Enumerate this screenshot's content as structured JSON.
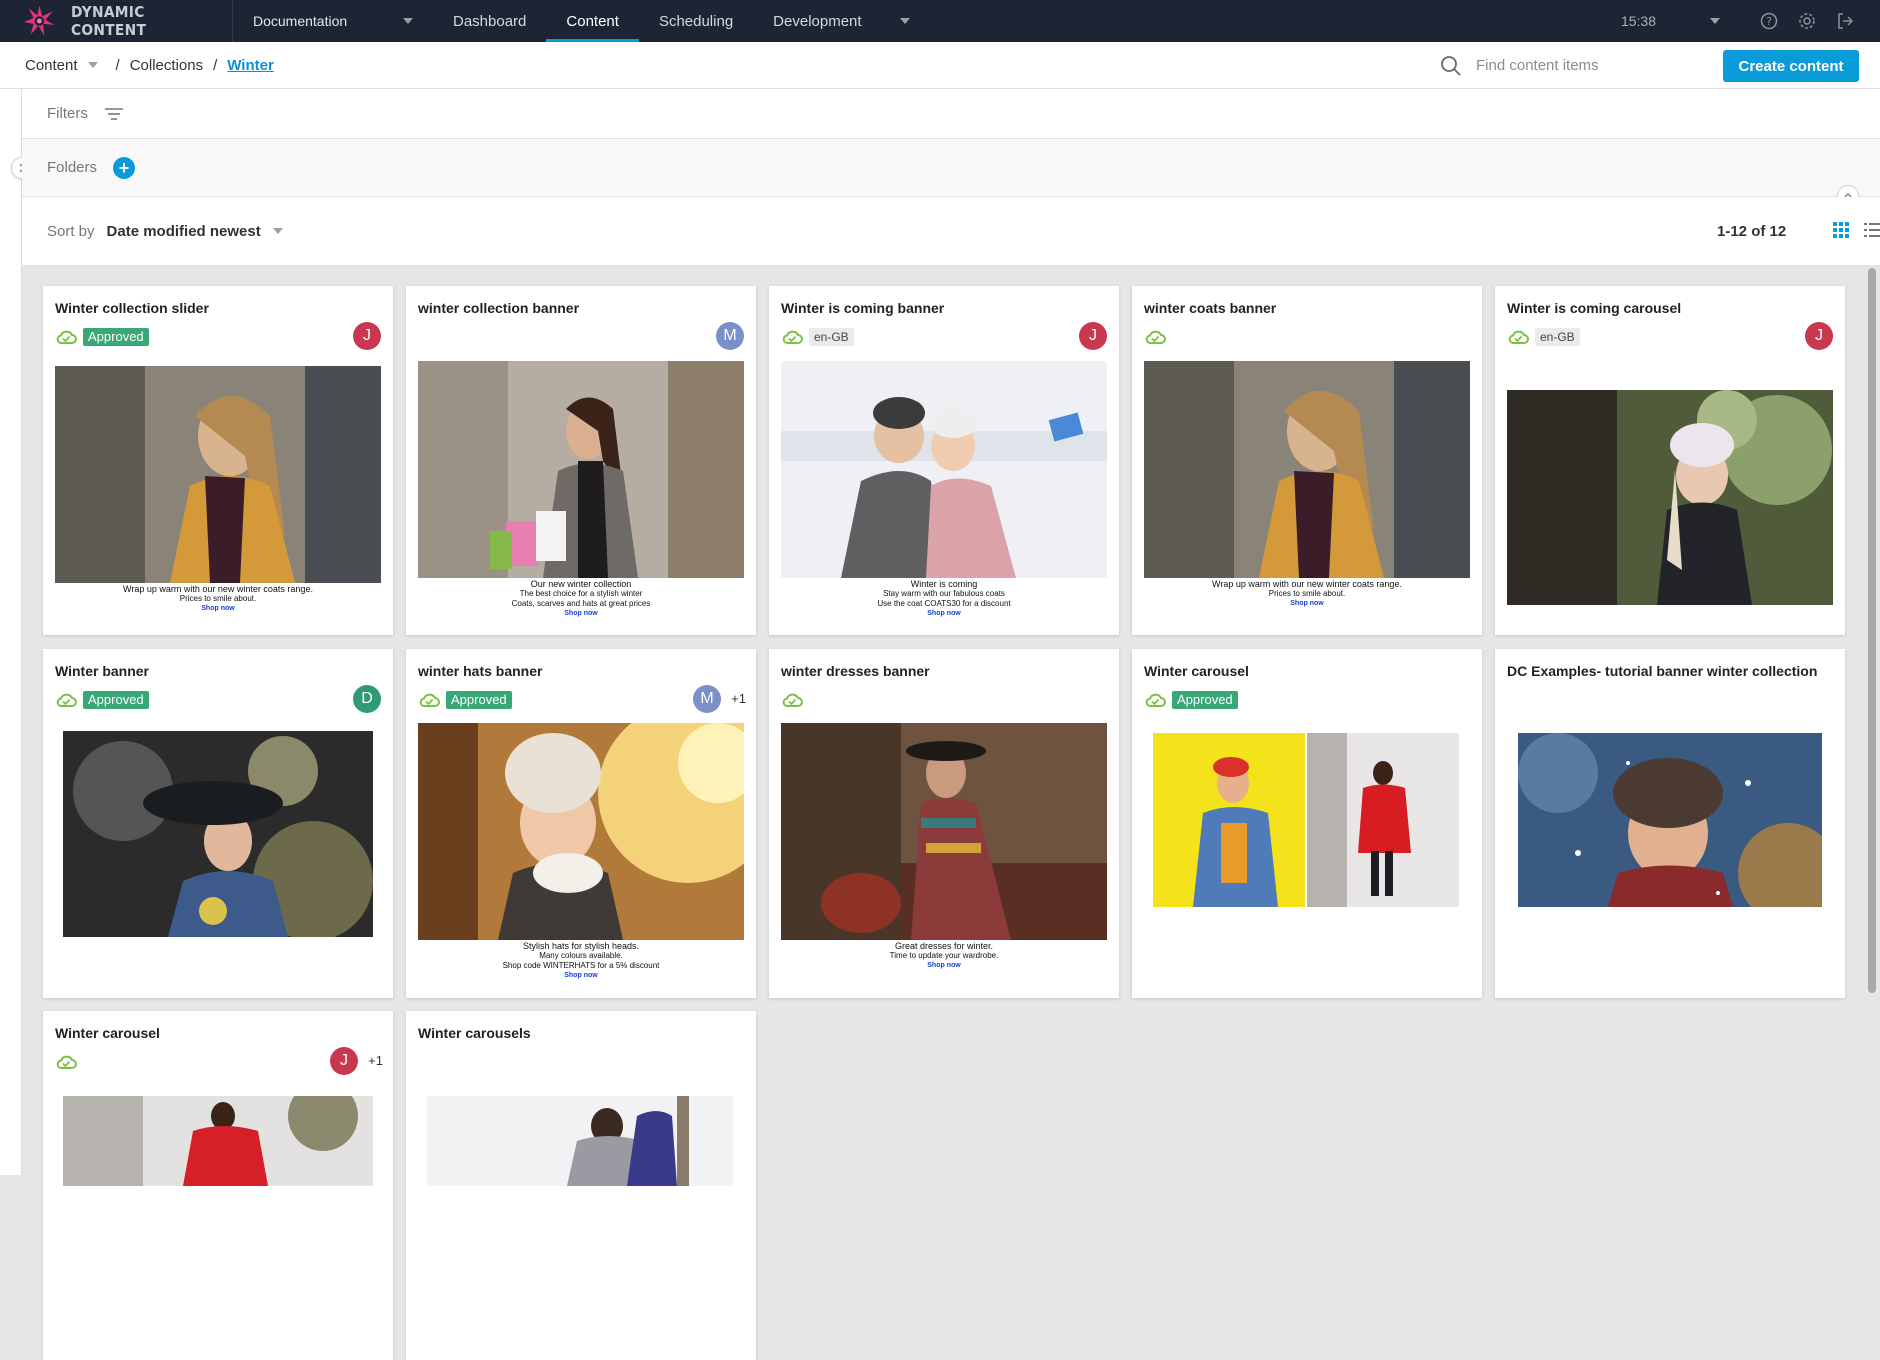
{
  "app": {
    "brand": "DYNAMIC CONTENT",
    "hub": "Documentation",
    "time": "15:38"
  },
  "nav": {
    "tabs": [
      "Dashboard",
      "Content",
      "Scheduling",
      "Development"
    ],
    "active": "Content"
  },
  "breadcrumb": {
    "root": "Content",
    "parent": "Collections",
    "current": "Winter",
    "sep": "/"
  },
  "search": {
    "placeholder": "Find content items"
  },
  "toolbar": {
    "create_label": "Create content"
  },
  "filters": {
    "label": "Filters"
  },
  "folders": {
    "label": "Folders"
  },
  "sort": {
    "label": "Sort by",
    "value": "Date modified newest"
  },
  "pagination": {
    "count": "1-12 of 12"
  },
  "colors": {
    "accent": "#0a9bd9",
    "nav_bg": "#1d2433",
    "approved": "#3aa776",
    "cloud": "#7ac143"
  },
  "cards": [
    {
      "title": "Winter collection slider",
      "status": "Approved",
      "locale": "",
      "avatar": "J",
      "extra": "",
      "banner": [
        "Wrap up warm with our new winter coats range.",
        "Prices to smile about.",
        "Shop now"
      ]
    },
    {
      "title": "winter collection banner",
      "status": "",
      "locale": "",
      "avatar": "M",
      "extra": "",
      "banner": [
        "Our new winter collection",
        "The best choice for a stylish winter",
        "Coats, scarves and hats at great prices",
        "Shop now"
      ]
    },
    {
      "title": "Winter is coming banner",
      "status": "",
      "locale": "en-GB",
      "avatar": "J",
      "extra": "",
      "banner": [
        "Winter is coming",
        "Stay warm with our fabulous coats",
        "Use the coat COATS30 for a discount",
        "Shop now"
      ]
    },
    {
      "title": "winter coats banner",
      "status": "",
      "locale": "",
      "avatar": "",
      "extra": "",
      "banner": [
        "Wrap up warm with our new winter coats range.",
        "Prices to smile about.",
        "Shop now"
      ]
    },
    {
      "title": "Winter is coming carousel",
      "status": "",
      "locale": "en-GB",
      "avatar": "J",
      "extra": "",
      "banner": []
    },
    {
      "title": "Winter banner",
      "status": "Approved",
      "locale": "",
      "avatar": "D",
      "extra": "",
      "banner": []
    },
    {
      "title": "winter hats banner",
      "status": "Approved",
      "locale": "",
      "avatar": "M",
      "extra": "+1",
      "banner": [
        "Stylish hats for stylish heads.",
        "Many colours available.",
        "Shop code WINTERHATS for a 5% discount",
        "Shop now"
      ]
    },
    {
      "title": "winter dresses banner",
      "status": "",
      "locale": "",
      "avatar": "",
      "extra": "",
      "banner": [
        "Great dresses for winter.",
        "Time to update your wardrobe.",
        "Shop now"
      ]
    },
    {
      "title": "Winter carousel",
      "status": "Approved",
      "locale": "",
      "avatar": "",
      "extra": "",
      "banner": []
    },
    {
      "title": "DC Examples- tutorial banner winter collection",
      "status": "",
      "locale": "",
      "avatar": "",
      "extra": "",
      "banner": []
    },
    {
      "title": "Winter carousel",
      "status": "",
      "locale": "",
      "avatar": "J",
      "extra": "+1",
      "banner": []
    },
    {
      "title": "Winter carousels",
      "status": "",
      "locale": "",
      "avatar": "",
      "extra": "",
      "banner": []
    }
  ]
}
